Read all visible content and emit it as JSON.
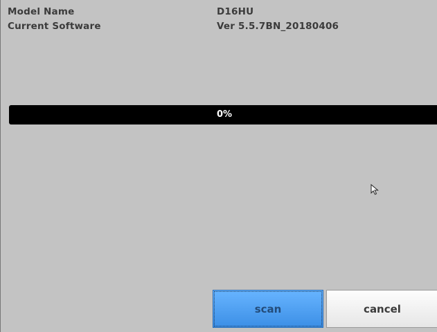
{
  "device_info": {
    "model_label": "Model Name",
    "model_value": "D16HU",
    "software_label": "Current Software",
    "software_value": "Ver  5.5.7BN_20180406"
  },
  "progress": {
    "percent": 0,
    "label": "0%",
    "track_color": "#000000",
    "fill_color": "#2f7fd6"
  },
  "buttons": {
    "scan_label": "scan",
    "cancel_label": "cancel"
  },
  "icons": {
    "cursor": "mouse-pointer-icon"
  }
}
